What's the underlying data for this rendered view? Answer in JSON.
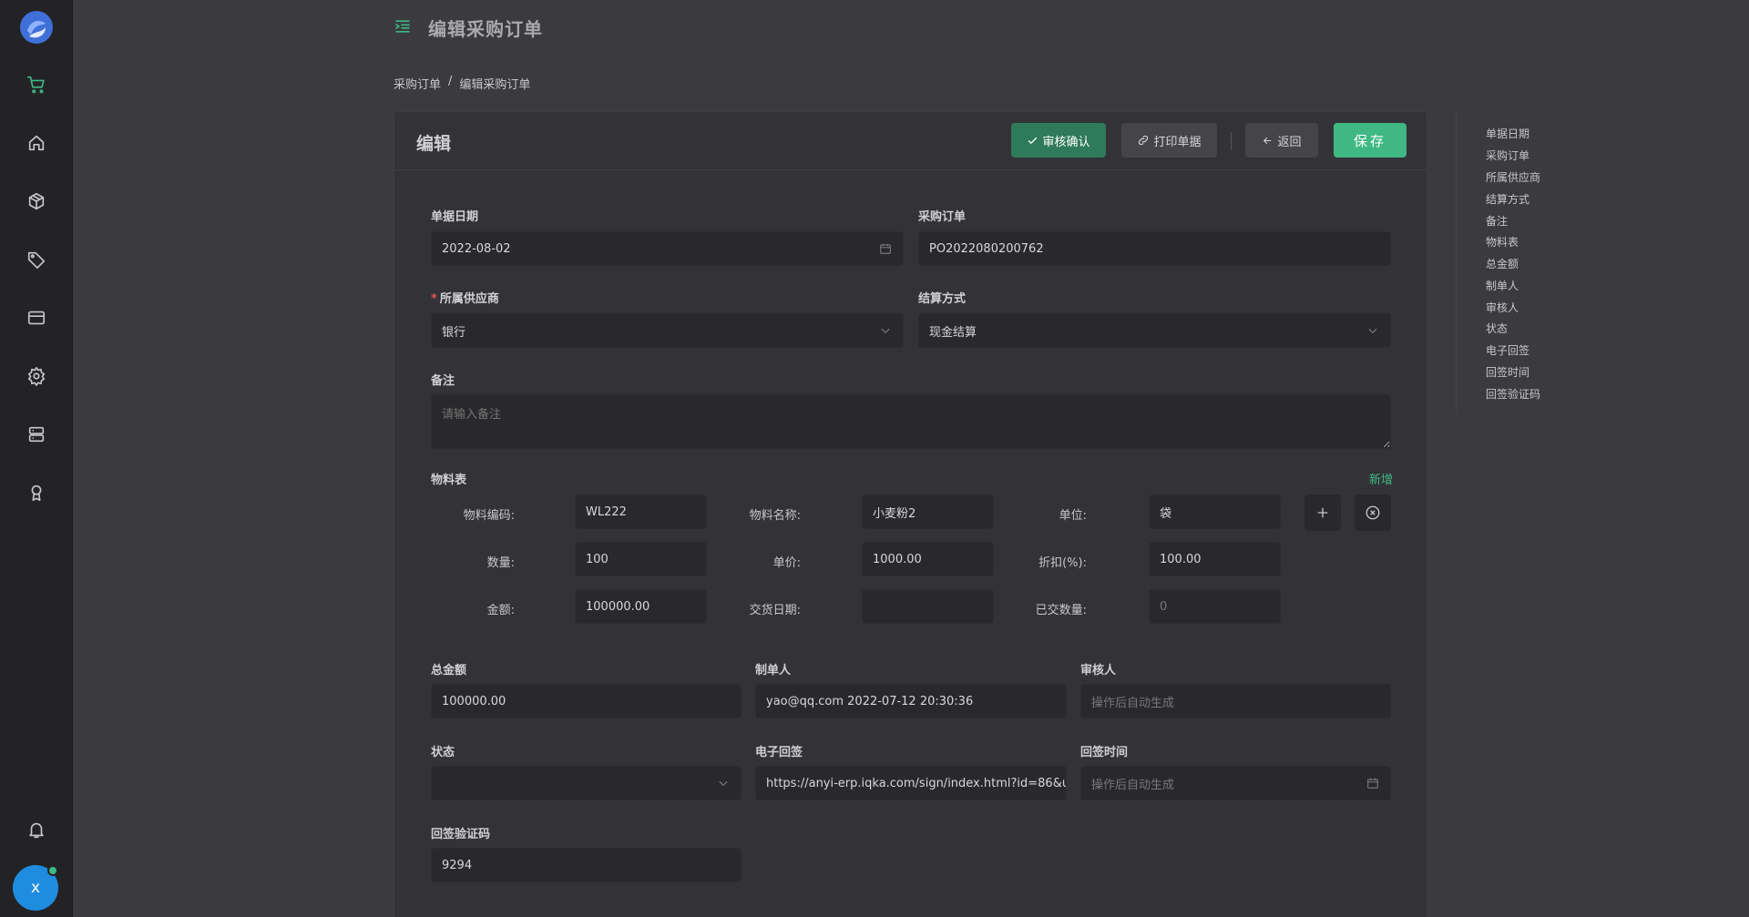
{
  "header": {
    "title": "编辑采购订单"
  },
  "breadcrumb": {
    "parent": "采购订单",
    "sep": "/",
    "current": "编辑采购订单"
  },
  "card": {
    "title": "编辑",
    "buttons": {
      "approve": "审核确认",
      "print": "打印单据",
      "back": "返回",
      "save": "保存"
    }
  },
  "form": {
    "bill_date": {
      "label": "单据日期",
      "value": "2022-08-02"
    },
    "po": {
      "label": "采购订单",
      "value": "PO2022080200762"
    },
    "supplier": {
      "label": "所属供应商",
      "value": "银行",
      "required": "*"
    },
    "settlement": {
      "label": "结算方式",
      "value": "现金结算"
    },
    "remark": {
      "label": "备注",
      "placeholder": "请输入备注"
    },
    "materials": {
      "label": "物料表",
      "add": "新增",
      "code_label": "物料编码:",
      "code": "WL222",
      "name_label": "物料名称:",
      "name": "小麦粉2",
      "unit_label": "单位:",
      "unit": "袋",
      "qty_label": "数量:",
      "qty": "100",
      "price_label": "单价:",
      "price": "1000.00",
      "discount_label": "折扣(%):",
      "discount": "100.00",
      "amount_label": "金额:",
      "amount": "100000.00",
      "delivery_label": "交货日期:",
      "delivery": "",
      "delivered_label": "已交数量:",
      "delivered_ph": "0"
    },
    "total": {
      "label": "总金额",
      "value": "100000.00"
    },
    "creator": {
      "label": "制单人",
      "value": "yao@qq.com 2022-07-12 20:30:36"
    },
    "auditor": {
      "label": "审核人",
      "placeholder": "操作后自动生成"
    },
    "status": {
      "label": "状态",
      "value": ""
    },
    "esign": {
      "label": "电子回签",
      "value": "https://anyi-erp.iqka.com/sign/index.html?id=86&u"
    },
    "sign_time": {
      "label": "回签时间",
      "placeholder": "操作后自动生成"
    },
    "sign_code": {
      "label": "回签验证码",
      "value": "9294"
    }
  },
  "anchors": [
    "单据日期",
    "采购订单",
    "所属供应商",
    "结算方式",
    "备注",
    "物料表",
    "总金额",
    "制单人",
    "审核人",
    "状态",
    "电子回签",
    "回签时间",
    "回签验证码"
  ],
  "user": {
    "avatar": "x"
  },
  "colors": {
    "accent": "#3fb884",
    "sidebar": "#232326",
    "background": "#3a3a3f"
  }
}
